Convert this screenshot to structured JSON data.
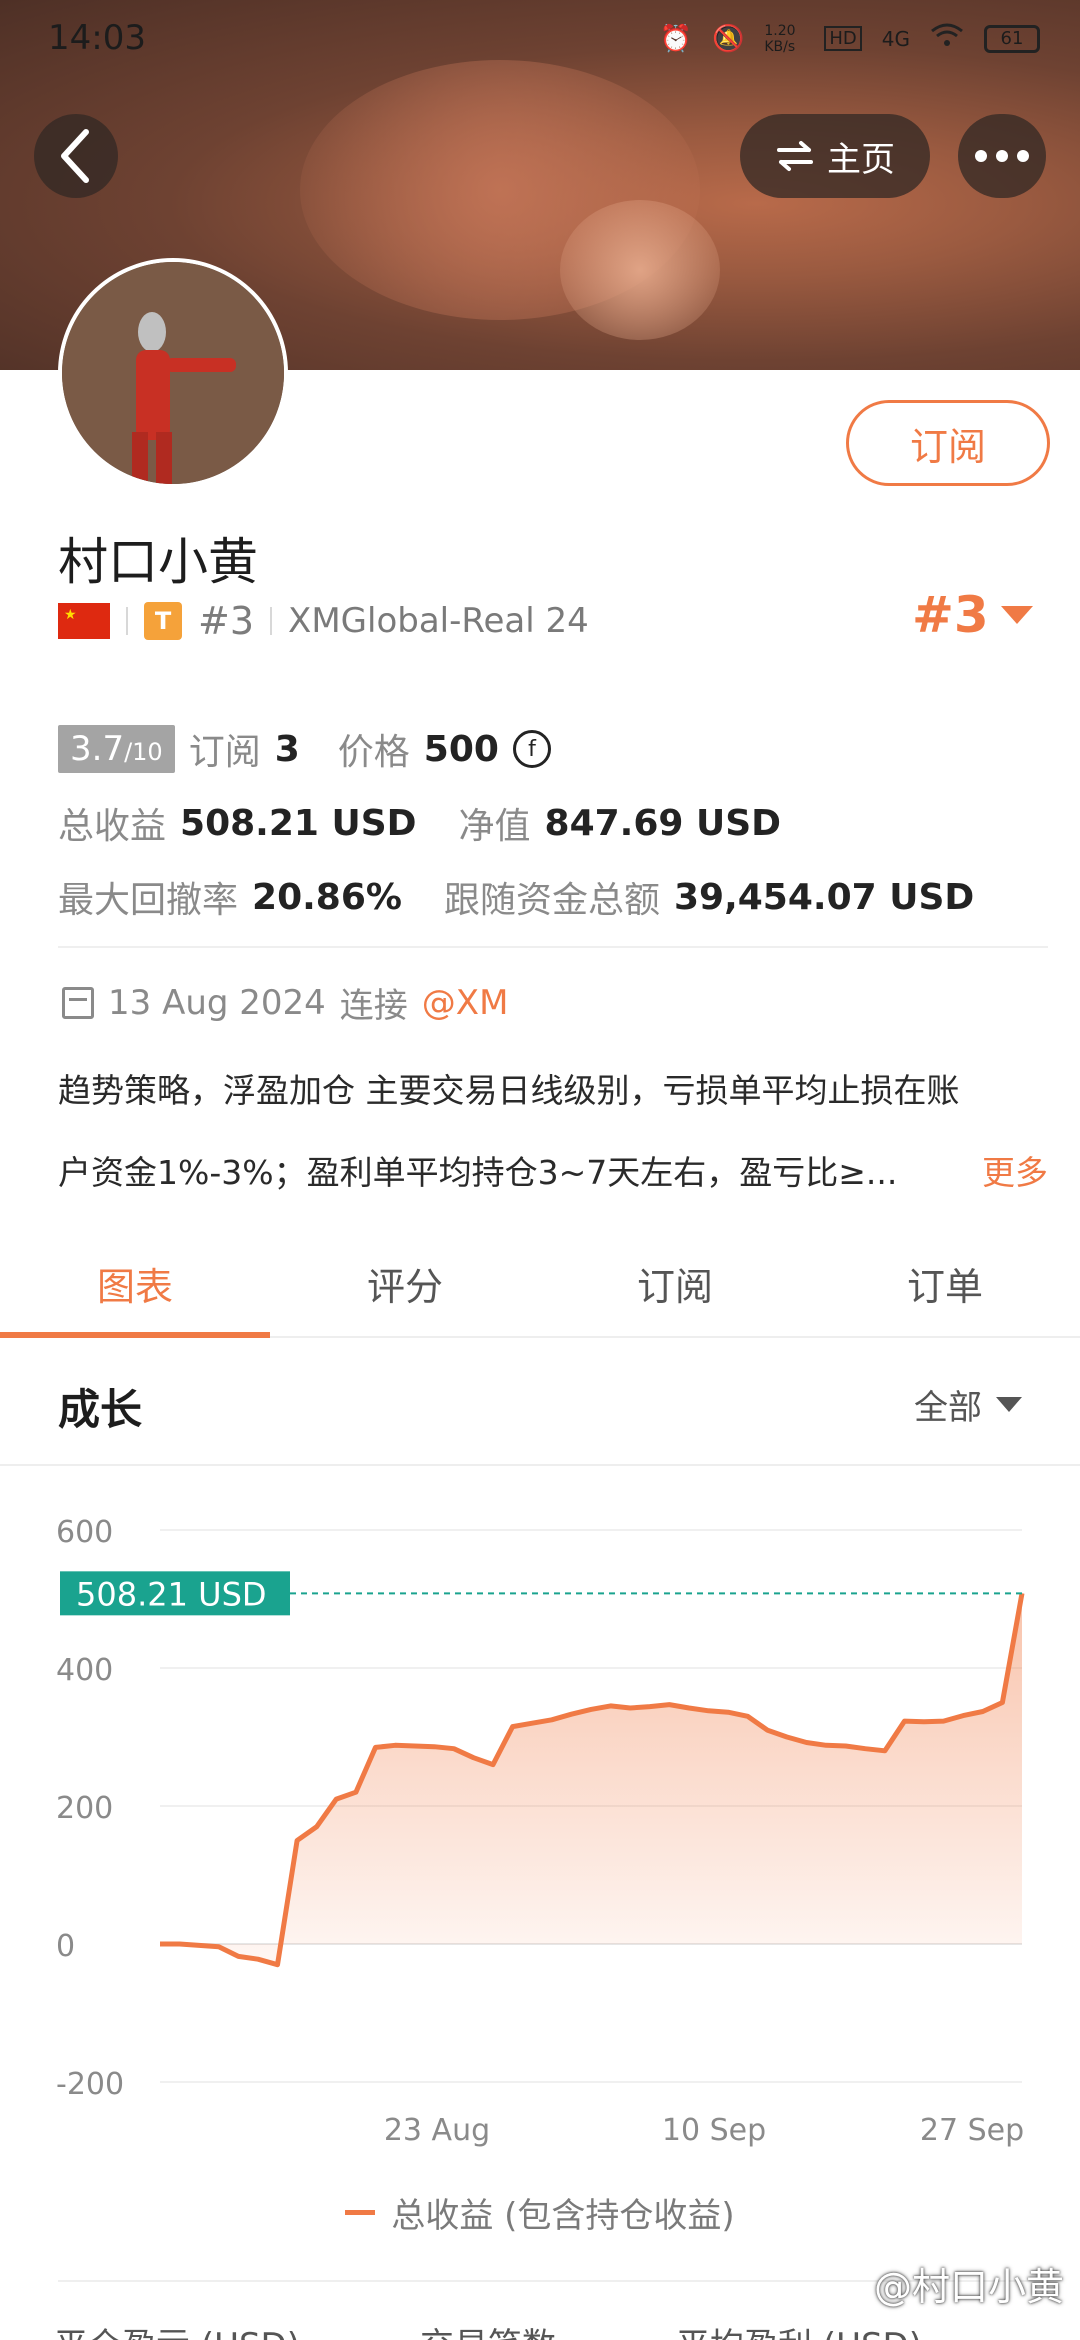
{
  "status_bar": {
    "time": "14:03",
    "network_speed": "1.20 KB/s",
    "hd_label": "HD",
    "signal_label": "4G",
    "battery": "61"
  },
  "header": {
    "home_label": "主页"
  },
  "profile": {
    "subscribe_label": "订阅",
    "name": "村口小黄",
    "tier_badge": "T",
    "rank_small": "#3",
    "account": "XMGlobal-Real 24",
    "rank_big": "#3"
  },
  "stats": {
    "rating_value": "3.7",
    "rating_scale": "/10",
    "subscriptions_label": "订阅",
    "subscriptions_value": "3",
    "price_label": "价格",
    "price_value": "500",
    "price_coin": "f",
    "total_profit_label": "总收益",
    "total_profit_value": "508.21 USD",
    "net_value_label": "净值",
    "net_value_value": "847.69 USD",
    "max_drawdown_label": "最大回撤率",
    "max_drawdown_value": "20.86%",
    "followed_funds_label": "跟随资金总额",
    "followed_funds_value": "39,454.07 USD"
  },
  "connection": {
    "date": "13 Aug 2024",
    "connect_label": "连接",
    "broker": "@XM"
  },
  "description": {
    "line1": "趋势策略，浮盈加仓 主要交易日线级别，亏损单平均止损在账",
    "line2": "户资金1%-3%；盈利单平均持仓3~7天左右，盈亏比≥...",
    "more_label": "更多"
  },
  "tabs": [
    {
      "label": "图表",
      "active": true
    },
    {
      "label": "评分",
      "active": false
    },
    {
      "label": "订阅",
      "active": false
    },
    {
      "label": "订单",
      "active": false
    }
  ],
  "growth": {
    "title": "成长",
    "filter_label": "全部"
  },
  "chart_data": {
    "type": "area",
    "title": "",
    "xlabel": "",
    "ylabel": "",
    "ylim": [
      -200,
      600
    ],
    "yticks": [
      "600",
      "400",
      "200",
      "0",
      "-200"
    ],
    "x_tick_labels": [
      "23 Aug",
      "10 Sep",
      "27 Sep"
    ],
    "current_value_label": "508.21 USD",
    "current_value": 508.21,
    "series": [
      {
        "name": "总收益 (包含持仓收益)",
        "color": "#f07a45",
        "values": [
          0,
          0,
          -2,
          -4,
          -18,
          -22,
          -30,
          150,
          170,
          210,
          220,
          285,
          288,
          287,
          286,
          283,
          270,
          260,
          315,
          320,
          325,
          333,
          340,
          345,
          342,
          344,
          347,
          342,
          338,
          336,
          330,
          310,
          300,
          292,
          288,
          287,
          283,
          280,
          323,
          322,
          323,
          331,
          337,
          350,
          508.21
        ]
      }
    ],
    "grid": true,
    "legend": "bottom",
    "legend_label": "总收益 (包含持仓收益)"
  },
  "bottom_row": {
    "col1": "平仓盈亏 (USD)",
    "col2": "交易笔数",
    "col3": "平均盈利 (USD)"
  },
  "watermark": "@村口小黄"
}
